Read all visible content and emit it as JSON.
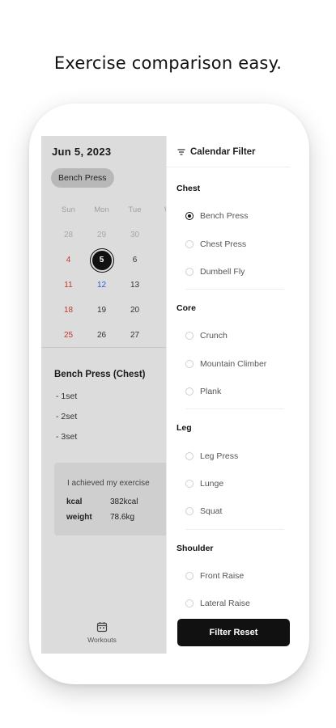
{
  "headline": "Exercise comparison easy.",
  "calendar": {
    "date_title": "Jun 5, 2023",
    "selected_chip": "Bench Press",
    "weekdays": [
      "Sun",
      "Mon",
      "Tue",
      "W"
    ],
    "weeks": [
      [
        "28",
        "29",
        "30",
        ""
      ],
      [
        "4",
        "5",
        "6",
        ""
      ],
      [
        "11",
        "12",
        "13",
        ""
      ],
      [
        "18",
        "19",
        "20",
        ""
      ],
      [
        "25",
        "26",
        "27",
        "2"
      ]
    ]
  },
  "exercise": {
    "title": "Bench Press (Chest)",
    "sets": [
      "- 1set",
      "- 2set",
      "- 3set"
    ],
    "summary_text": "I achieved my exercise",
    "kcal_label": "kcal",
    "kcal_value": "382kcal",
    "weight_label": "weight",
    "weight_value": "78.6kg"
  },
  "tabbar": {
    "workouts_label": "Workouts"
  },
  "drawer": {
    "title": "Calendar Filter",
    "groups": [
      {
        "title": "Chest",
        "options": [
          "Bench Press",
          "Chest Press",
          "Dumbell Fly"
        ]
      },
      {
        "title": "Core",
        "options": [
          "Crunch",
          "Mountain Climber",
          "Plank"
        ]
      },
      {
        "title": "Leg",
        "options": [
          "Leg Press",
          "Lunge",
          "Squat"
        ]
      },
      {
        "title": "Shoulder",
        "options": [
          "Front Raise",
          "Lateral Raise"
        ]
      }
    ],
    "selected_option": "Bench Press",
    "reset_label": "Filter Reset"
  }
}
